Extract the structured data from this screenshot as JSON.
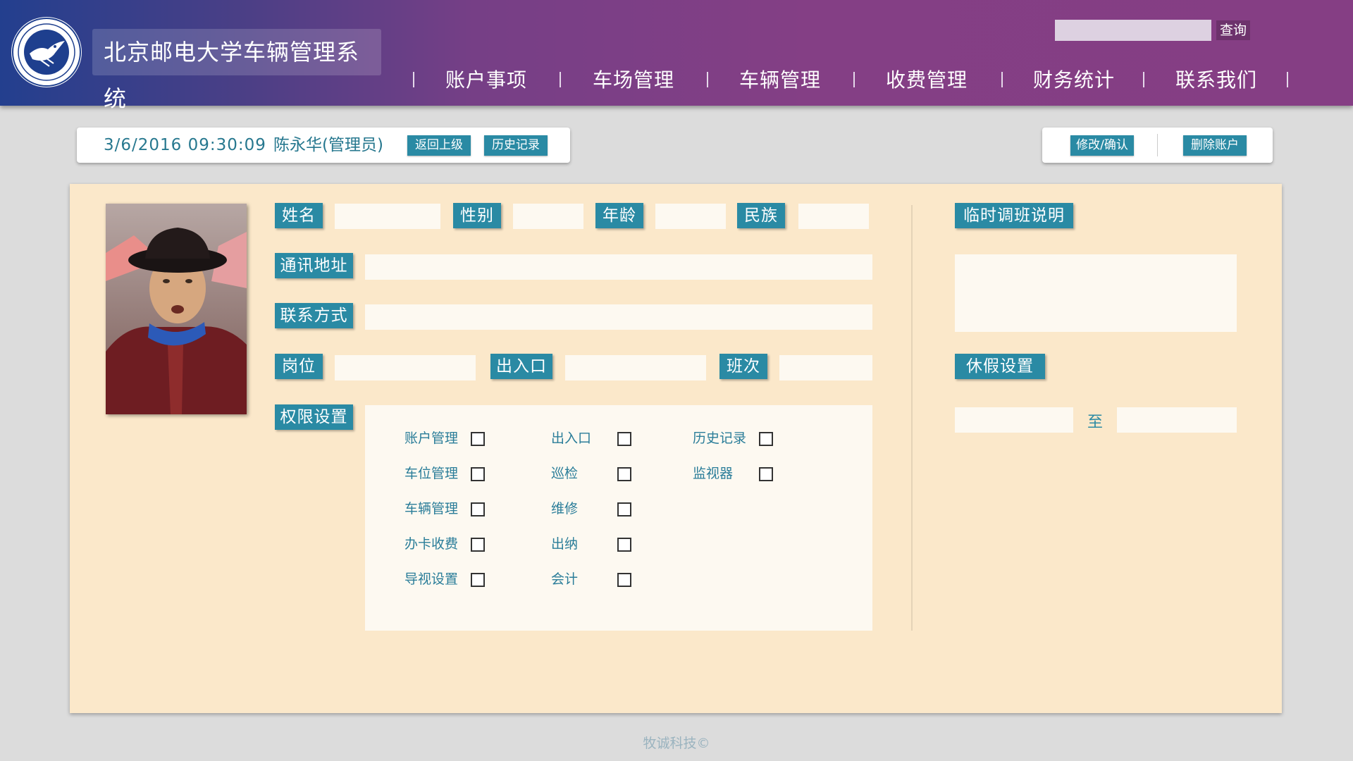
{
  "header": {
    "system_title": "北京邮电大学车辆管理系统",
    "logo_icon": "university-seal-icon",
    "search_placeholder": "",
    "search_button": "查询",
    "nav": [
      "账户事项",
      "车场管理",
      "车辆管理",
      "收费管理",
      "财务统计",
      "联系我们"
    ]
  },
  "info": {
    "datetime": "3/6/2016 09:30:09",
    "user": "陈永华(管理员)",
    "back_button": "返回上级",
    "history_button": "历史记录",
    "edit_button": "修改/确认",
    "delete_button": "删除账户"
  },
  "form": {
    "name_label": "姓名",
    "gender_label": "性别",
    "age_label": "年龄",
    "ethnicity_label": "民族",
    "address_label": "通讯地址",
    "contact_label": "联系方式",
    "position_label": "岗位",
    "gate_label": "出入口",
    "shift_label": "班次",
    "permissions_label": "权限设置",
    "values": {
      "name": "",
      "gender": "",
      "age": "",
      "ethnicity": "",
      "address": "",
      "contact": "",
      "position": "",
      "gate": "",
      "shift": ""
    }
  },
  "permissions": {
    "col1": [
      "账户管理",
      "车位管理",
      "车辆管理",
      "办卡收费",
      "导视设置"
    ],
    "col2": [
      "出入口",
      "巡检",
      "维修",
      "出纳",
      "会计"
    ],
    "col3": [
      "历史记录",
      "监视器"
    ]
  },
  "right_panel": {
    "shift_note_label": "临时调班说明",
    "shift_note_value": "",
    "vacation_label": "休假设置",
    "vacation_from": "",
    "to_text": "至",
    "vacation_to": ""
  },
  "footer": "牧诚科技©",
  "colors": {
    "accent": "#2a8aa4",
    "header_left": "#233f8e",
    "header_right": "#853e84",
    "panel": "#fbe8ca",
    "text": "#27788f"
  }
}
